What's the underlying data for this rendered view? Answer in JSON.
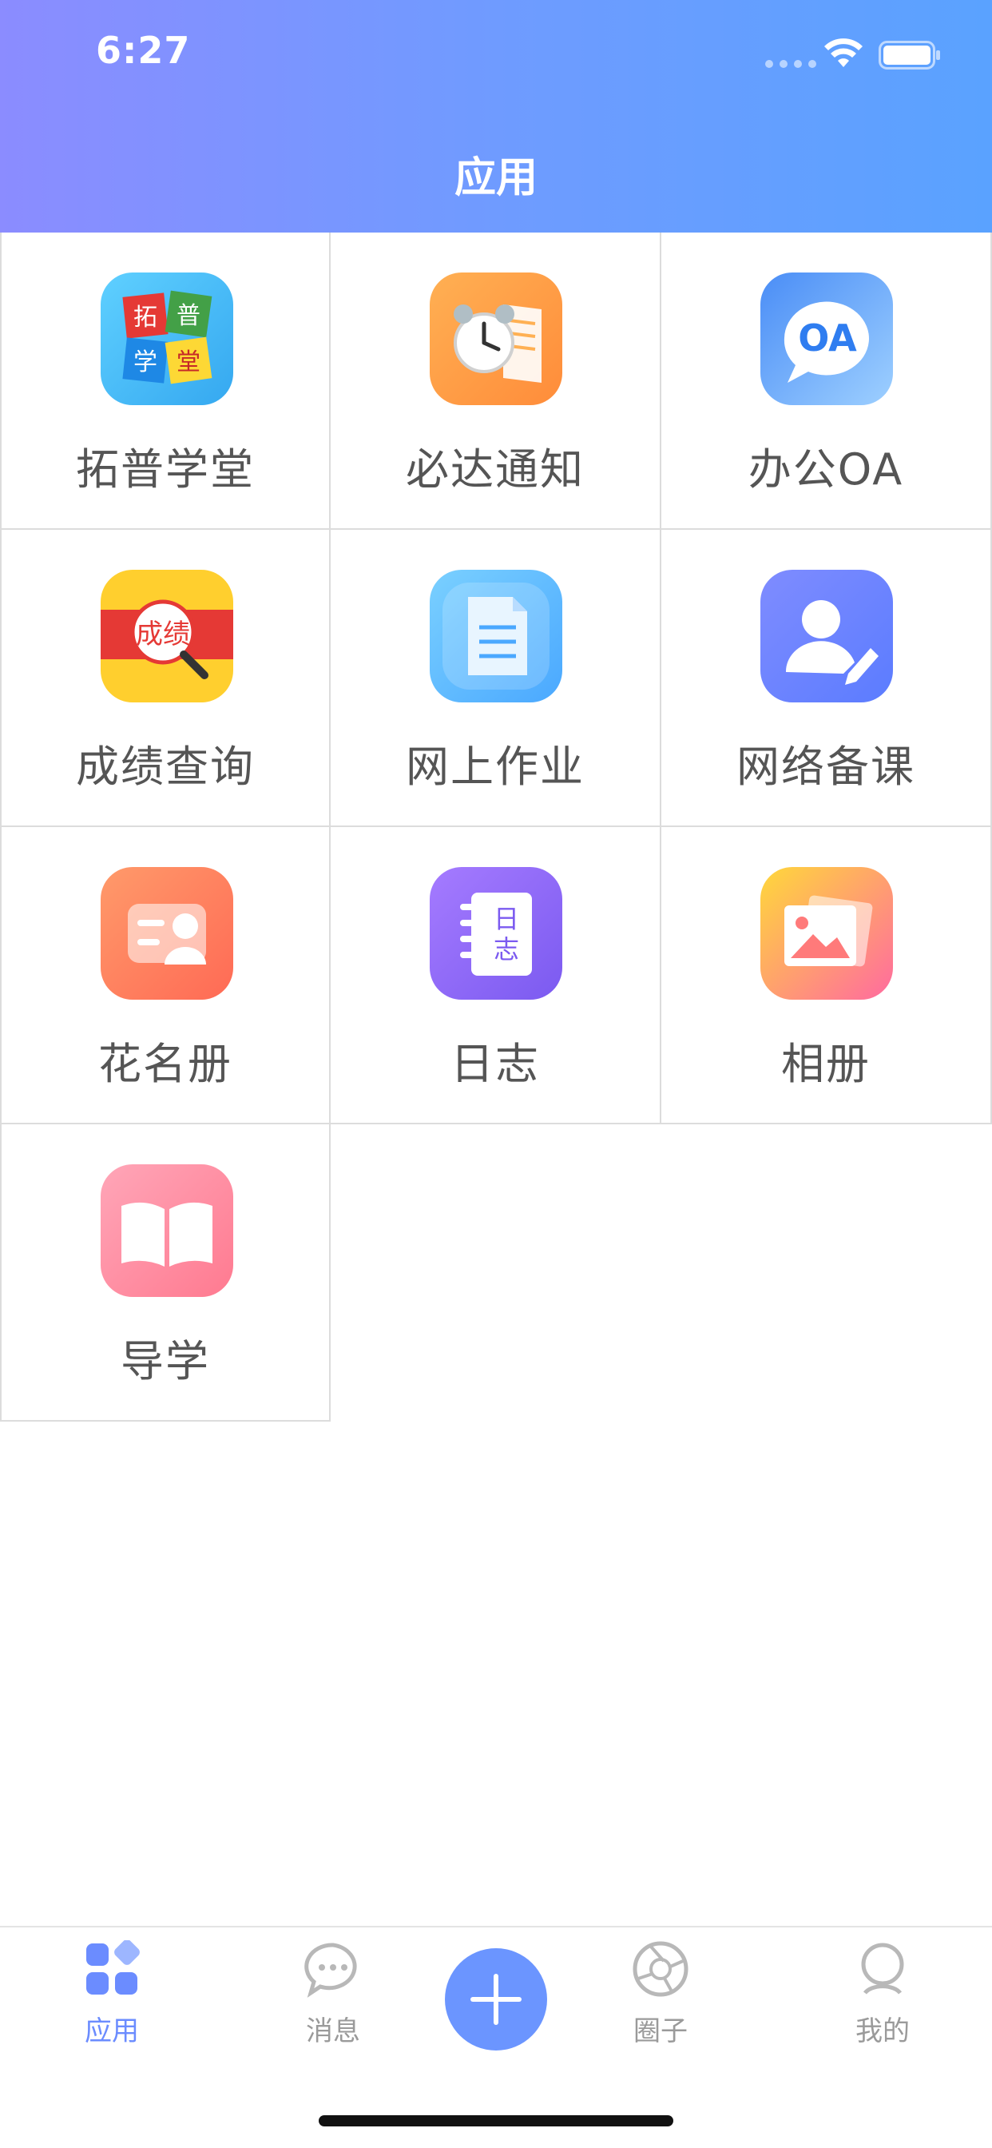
{
  "status_bar": {
    "time": "6:27"
  },
  "header": {
    "title": "应用"
  },
  "apps": [
    {
      "label": "拓普学堂",
      "icon": "tuopu-xuetang-icon"
    },
    {
      "label": "必达通知",
      "icon": "alarm-clock-icon"
    },
    {
      "label": "办公OA",
      "icon": "oa-bubble-icon",
      "icon_text": "OA"
    },
    {
      "label": "成绩查询",
      "icon": "grade-search-icon",
      "icon_text": "成绩"
    },
    {
      "label": "网上作业",
      "icon": "document-icon"
    },
    {
      "label": "网络备课",
      "icon": "user-edit-icon"
    },
    {
      "label": "花名册",
      "icon": "roster-card-icon"
    },
    {
      "label": "日志",
      "icon": "notebook-icon",
      "icon_text_1": "日",
      "icon_text_2": "志"
    },
    {
      "label": "相册",
      "icon": "photo-album-icon"
    },
    {
      "label": "导学",
      "icon": "open-book-icon"
    }
  ],
  "tuopu_icon_chars": [
    "拓",
    "普",
    "学",
    "堂"
  ],
  "tabbar": {
    "items": [
      {
        "label": "应用",
        "icon": "apps-grid-icon",
        "active": true
      },
      {
        "label": "消息",
        "icon": "chat-bubble-icon",
        "active": false
      },
      {
        "label": "圈子",
        "icon": "aperture-icon",
        "active": false
      },
      {
        "label": "我的",
        "icon": "user-icon",
        "active": false
      }
    ],
    "fab_icon": "plus-icon"
  },
  "colors": {
    "accent": "#6b8cff",
    "header_start": "#8b8cff",
    "header_end": "#5aa2ff"
  }
}
